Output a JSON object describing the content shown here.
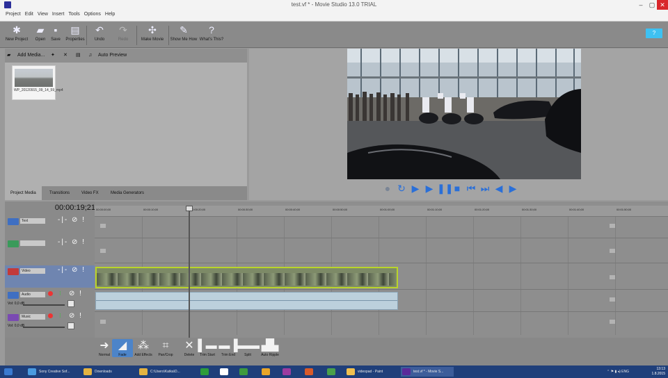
{
  "window": {
    "title": "test.vf * - Movie Studio 13.0 TRIAL",
    "min": "–",
    "max": "▢",
    "close": "✕"
  },
  "menu": [
    "Project",
    "Edit",
    "View",
    "Insert",
    "Tools",
    "Options",
    "Help"
  ],
  "toolbar": {
    "new_project": "New Project",
    "open": "Open",
    "save": "Save",
    "properties": "Properties",
    "undo": "Undo",
    "redo": "Redo",
    "make_movie": "Make Movie",
    "show_me_how": "Show Me How",
    "whats_this": "What's This?",
    "help": "?"
  },
  "media": {
    "add_media": "Add Media...",
    "auto_preview": "Auto Preview",
    "thumb_caption": "WP_20120915_09_14_59_mp4",
    "tabs": [
      "Project Media",
      "Transitions",
      "Video FX",
      "Media Generators"
    ]
  },
  "timeline": {
    "timecode": "00:00:19;21",
    "ruler": [
      "00:00:00;00",
      "00:00:10;00",
      "00:00:20;00",
      "00:00:30;00",
      "00:00:40;00",
      "00:00:50;00",
      "00:01:00;00",
      "00:01:10;00",
      "00:01:20;00",
      "00:01:30;00",
      "00:01:40;00",
      "00:01:50;00"
    ],
    "tracks": [
      {
        "name": "Text",
        "color": "#3f6fc2"
      },
      {
        "name": "",
        "color": "#3a9a5a"
      },
      {
        "name": "Video",
        "color": "#c23a3a"
      },
      {
        "name": "Audio",
        "color": "#3f6fc2",
        "vol": "Vol:",
        "db": "0,0 dB"
      },
      {
        "name": "Music",
        "color": "#7a4ab2",
        "vol": "Vol:",
        "db": "0,0 dB"
      }
    ],
    "controls": "-|- ⊘ !"
  },
  "edit_tools": [
    "Normal",
    "Fade",
    "Add Effects",
    "Pan/Crop",
    "Delete",
    "Trim Start",
    "Trim End",
    "Split",
    "Auto Ripple"
  ],
  "taskbar": {
    "items": [
      {
        "label": "Sony Creative Sof...",
        "color": "#4a9be0"
      },
      {
        "label": "Downloads",
        "color": "#e3b342"
      },
      {
        "label": "C:\\Users\\Katka\\D...",
        "color": "#e3b342"
      },
      {
        "label": "",
        "color": "#2e9d3a"
      },
      {
        "label": "",
        "color": "#ffffff"
      },
      {
        "label": "",
        "color": "#3e9a3e"
      },
      {
        "label": "",
        "color": "#e8a52a"
      },
      {
        "label": "",
        "color": "#9c3ca0"
      },
      {
        "label": "",
        "color": "#d85a2a"
      },
      {
        "label": "",
        "color": "#4aa04a"
      },
      {
        "label": "videopad - Paint",
        "color": "#f0c050"
      },
      {
        "label": "test.vf * - Movie S...",
        "color": "#5a2a9a"
      }
    ],
    "lang": "ENG",
    "time": "13:13",
    "date": "1.8.2015"
  }
}
